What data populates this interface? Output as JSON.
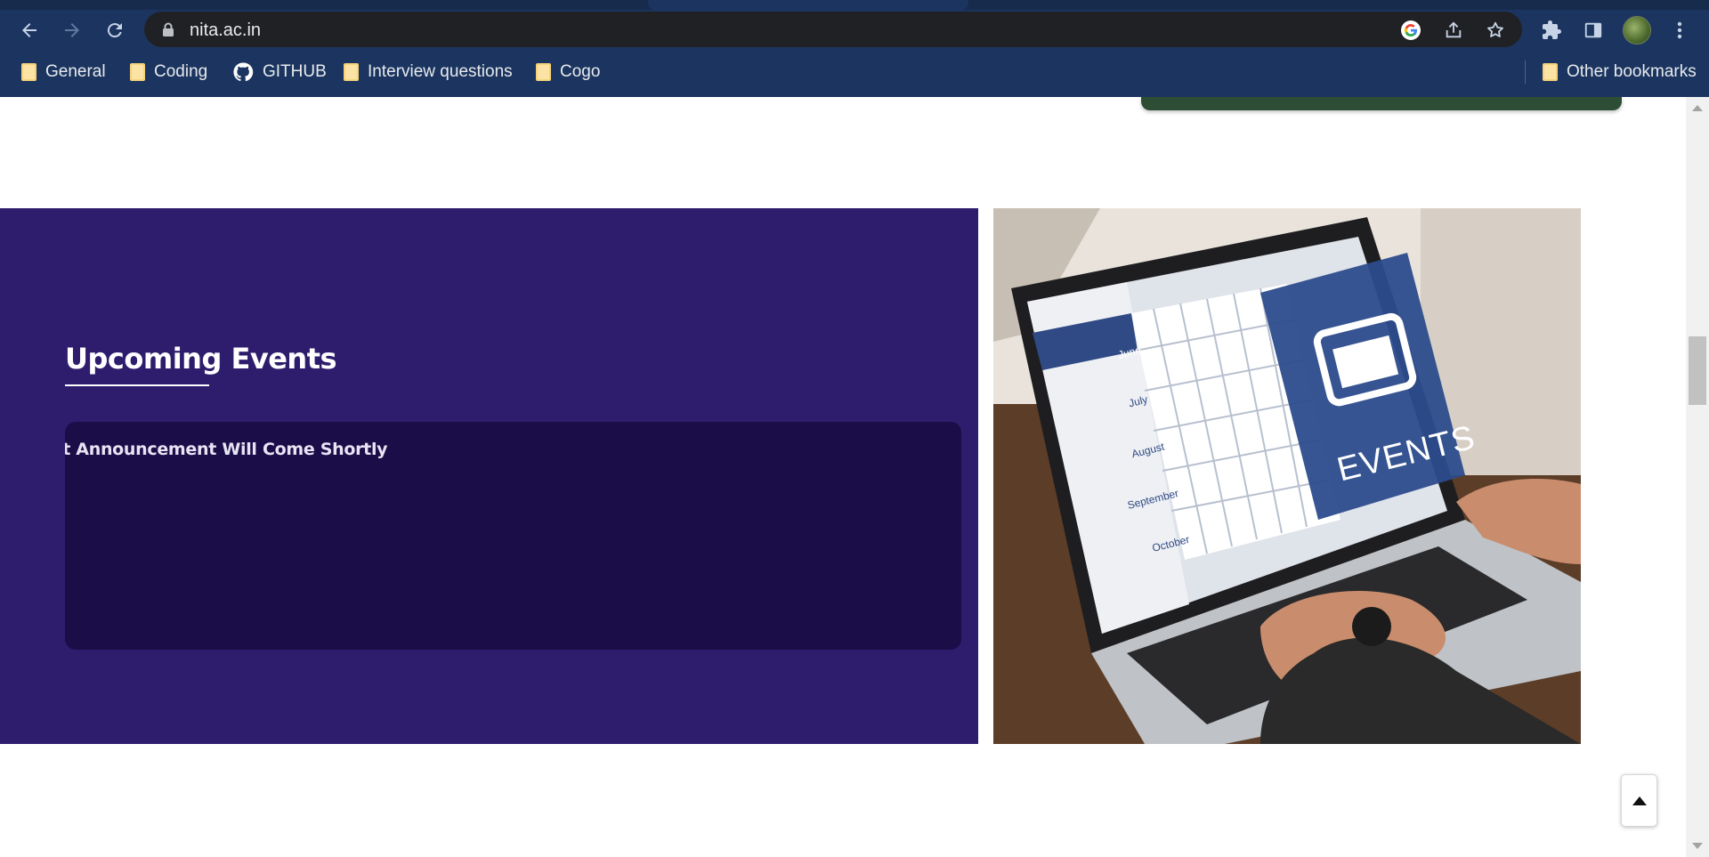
{
  "browser": {
    "url": "nita.ac.in",
    "bookmarks": [
      {
        "label": "General",
        "icon": "folder-icon"
      },
      {
        "label": "Coding",
        "icon": "folder-icon"
      },
      {
        "label": "GITHUB",
        "icon": "github-icon"
      },
      {
        "label": "Interview questions",
        "icon": "folder-icon"
      },
      {
        "label": "Cogo",
        "icon": "folder-icon"
      }
    ],
    "other_bookmarks": "Other bookmarks"
  },
  "events": {
    "title": "Upcoming Events",
    "announcement": "ıt Announcement Will Come Shortly",
    "image_calendar": {
      "months": [
        "June",
        "July",
        "August",
        "September",
        "October"
      ],
      "badge": "EVENTS"
    }
  },
  "colors": {
    "chrome": "#1b3560",
    "panel": "#2e1d6d",
    "announce_box": "#1a0d48"
  }
}
